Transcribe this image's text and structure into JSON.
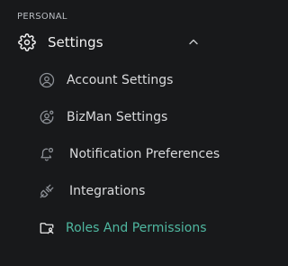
{
  "section": {
    "label": "PERSONAL"
  },
  "group": {
    "title": "Settings",
    "icon": "gear-icon",
    "expanded": true,
    "toggle_icon": "chevron-up-icon"
  },
  "items": [
    {
      "label": "Account Settings",
      "icon": "user-circle-icon",
      "active": false
    },
    {
      "label": "BizMan Settings",
      "icon": "user-gear-icon",
      "active": false
    },
    {
      "label": "Notification Preferences",
      "icon": "bell-icon",
      "active": false
    },
    {
      "label": "Integrations",
      "icon": "plug-icon",
      "active": false
    },
    {
      "label": "Roles And Permissions",
      "icon": "folder-user-icon",
      "active": true
    }
  ],
  "colors": {
    "background": "#18191b",
    "text": "#d9dadc",
    "muted": "#8c9096",
    "active": "#4fb7a0"
  }
}
